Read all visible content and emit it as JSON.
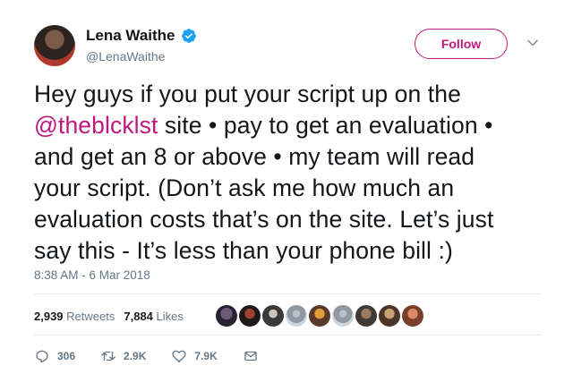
{
  "author": {
    "display_name": "Lena Waithe",
    "handle": "@LenaWaithe"
  },
  "follow_label": "Follow",
  "tweet": {
    "line1": "Hey guys if you put your script up on the",
    "mention": "@theblcklst",
    "line2_rest": " site • pay to get an evaluation •",
    "line3": "and get an 8 or above • my team will read",
    "line4": "your script. (Don’t ask me how much an",
    "line5": "evaluation costs that’s on the site. Let’s just",
    "line6": "say this - It’s less than your phone bill :)"
  },
  "timestamp": "8:38 AM - 6 Mar 2018",
  "stats": {
    "retweets_count": "2,939",
    "retweets_label": "Retweets",
    "likes_count": "7,884",
    "likes_label": "Likes"
  },
  "actions": {
    "replies": "306",
    "retweets": "2.9K",
    "likes": "7.9K"
  },
  "colors": {
    "accent": "#c0177f",
    "verified": "#1da1f2",
    "muted": "#657786"
  }
}
